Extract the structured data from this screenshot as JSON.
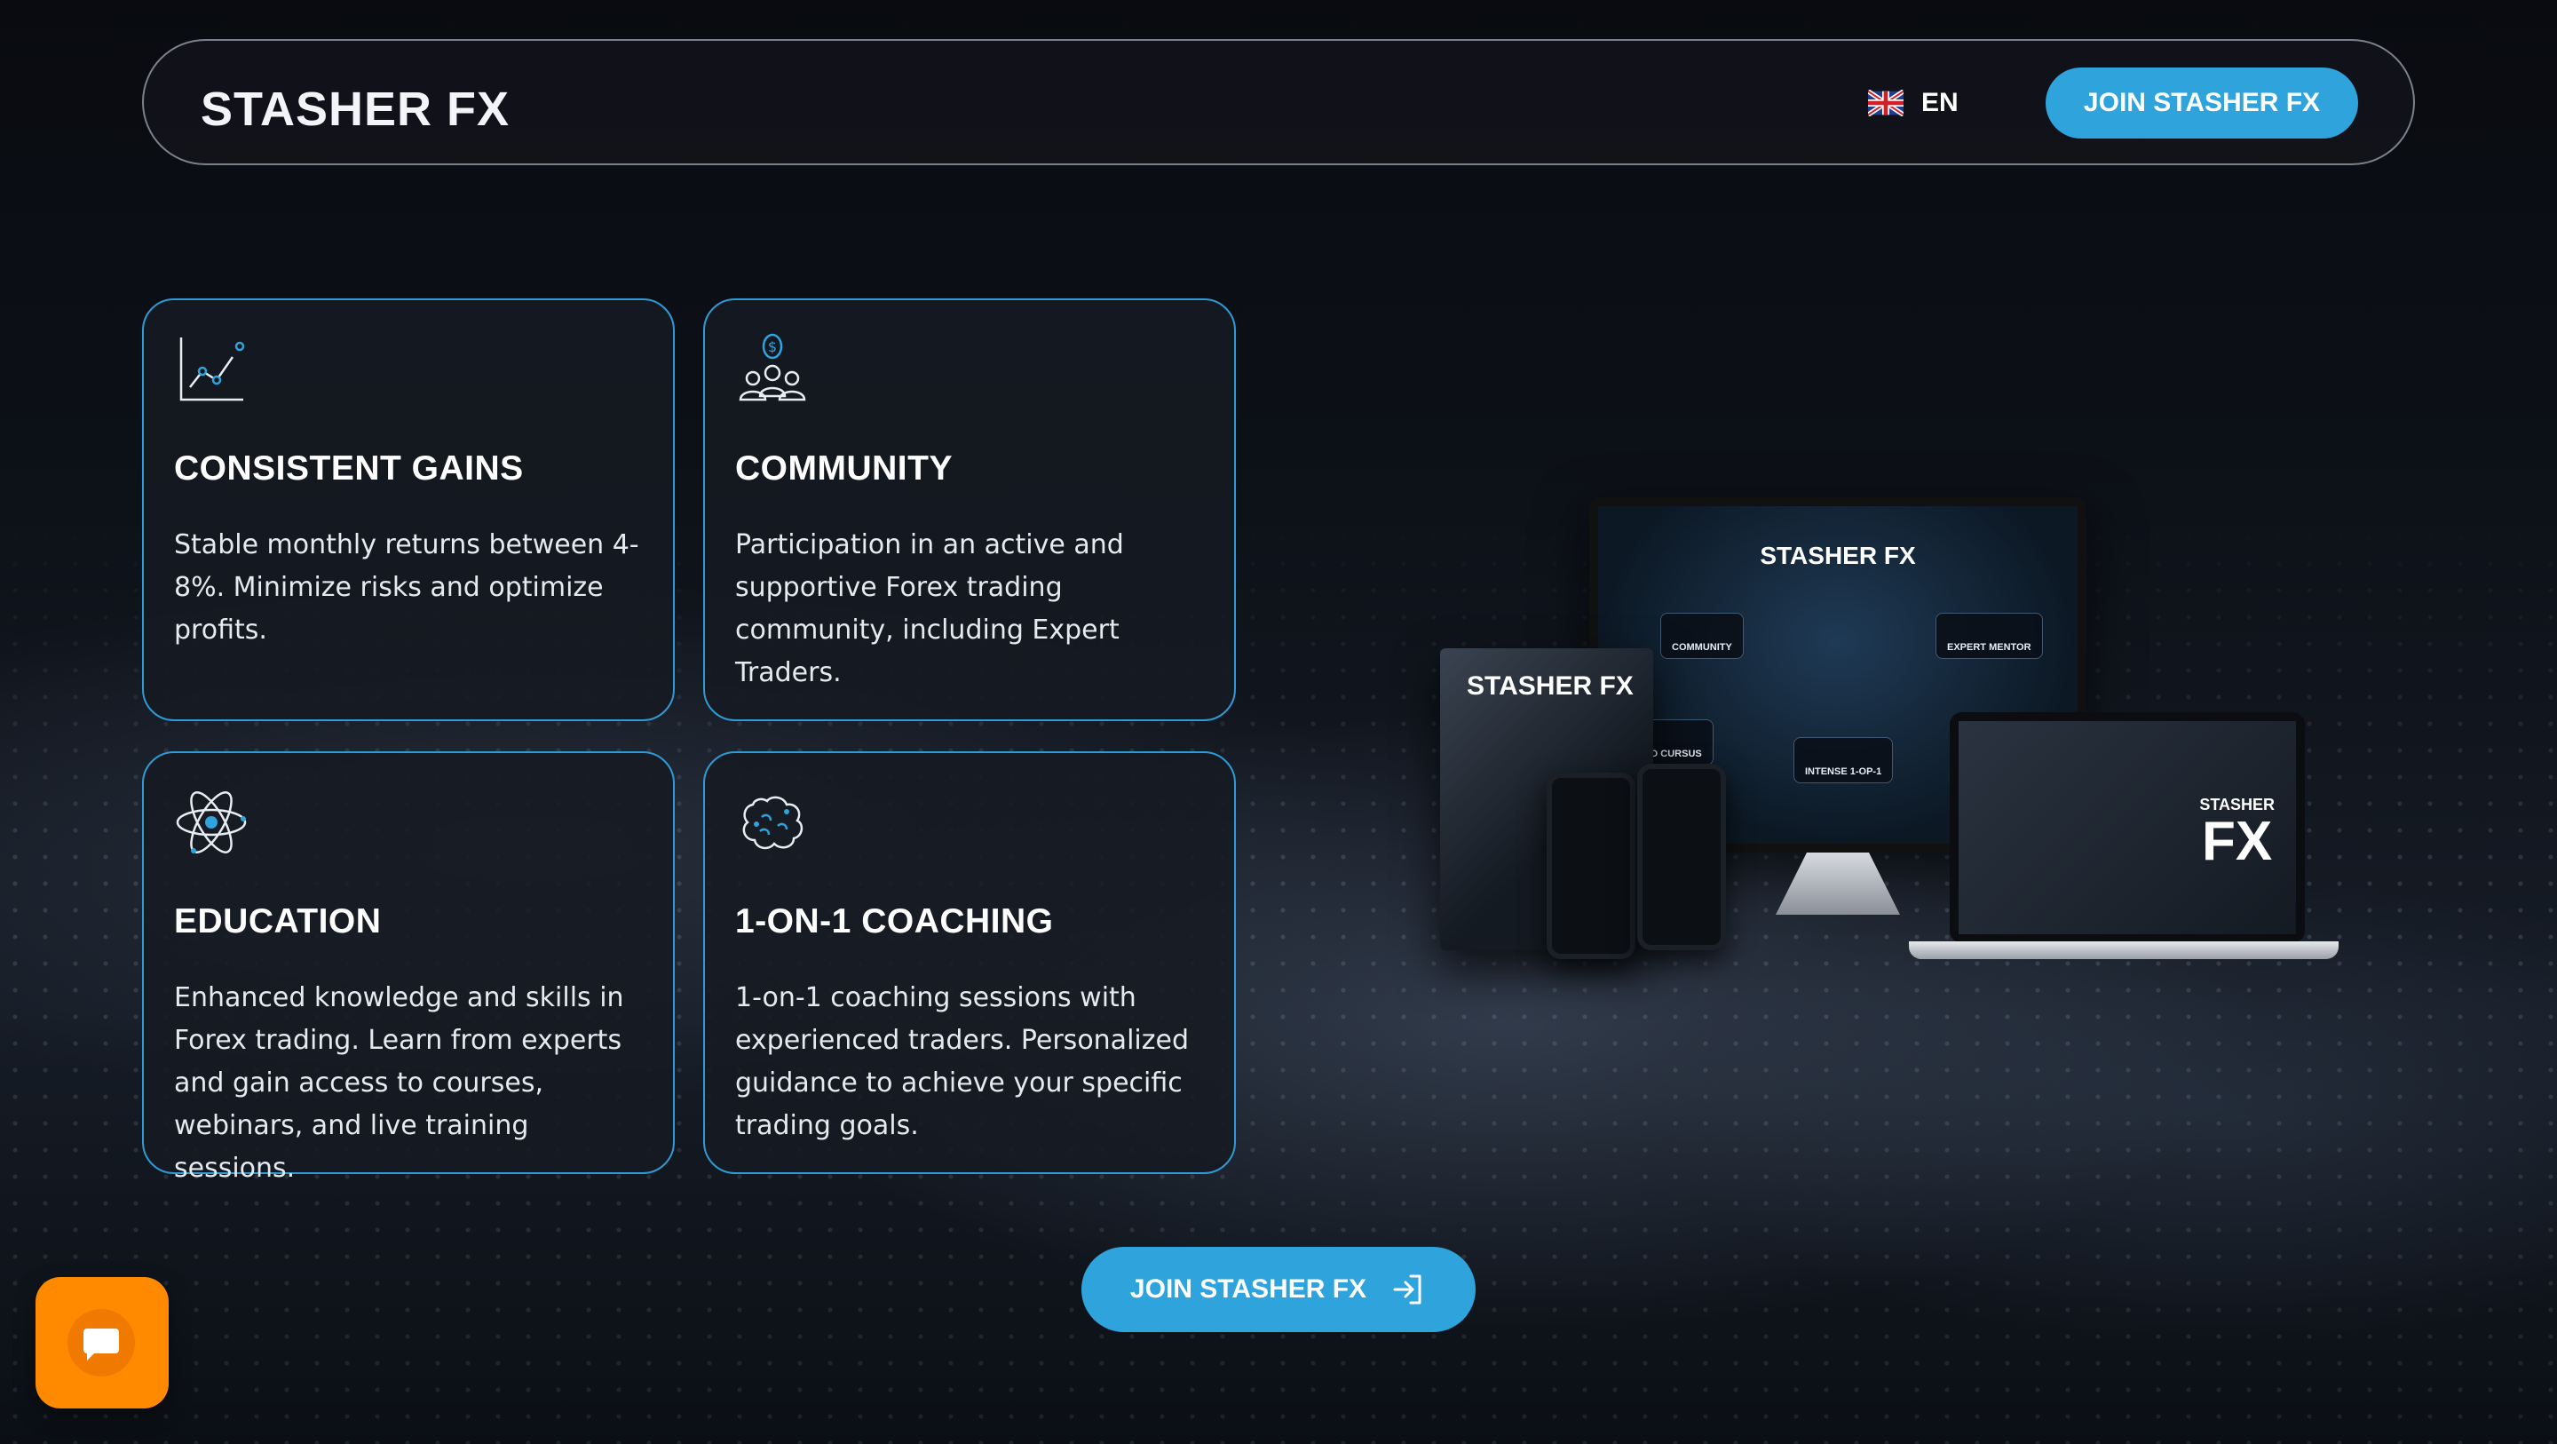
{
  "header": {
    "logo": "STASHER FX",
    "language": "EN",
    "cta_label": "JOIN STASHER FX"
  },
  "cards": [
    {
      "title": "CONSISTENT GAINS",
      "description": "Stable monthly returns between 4-8%. Minimize risks and optimize profits.",
      "icon": "chart-line-icon"
    },
    {
      "title": "COMMUNITY",
      "description": "Participation in an active and supportive Forex trading community, including Expert Traders.",
      "icon": "community-dollar-icon"
    },
    {
      "title": "EDUCATION",
      "description": "Enhanced knowledge and skills in Forex trading. Learn from experts and gain access to courses, webinars, and live training sessions.",
      "icon": "atom-icon"
    },
    {
      "title": "1-ON-1 COACHING",
      "description": "1-on-1 coaching sessions with experienced traders. Personalized guidance to achieve your specific trading goals.",
      "icon": "brain-icon"
    }
  ],
  "mockup": {
    "monitor_logo": "STASHER FX",
    "box_logo": "STASHER FX",
    "laptop_logo_small": "STASHER",
    "laptop_logo_big": "FX",
    "chips": [
      "COMMUNITY",
      "EXPERT MENTOR",
      "VIDEO CURSUS",
      "INTENSE 1-OP-1"
    ]
  },
  "cta_bottom": {
    "label": "JOIN STASHER FX",
    "icon": "sign-in-arrow-icon"
  },
  "chat_widget": {
    "icon": "chat-bubble-icon",
    "color": "#ff8a00"
  },
  "colors": {
    "accent": "#2ea3dc",
    "card_border": "#2f9bd6",
    "background": "#0a0e14"
  }
}
